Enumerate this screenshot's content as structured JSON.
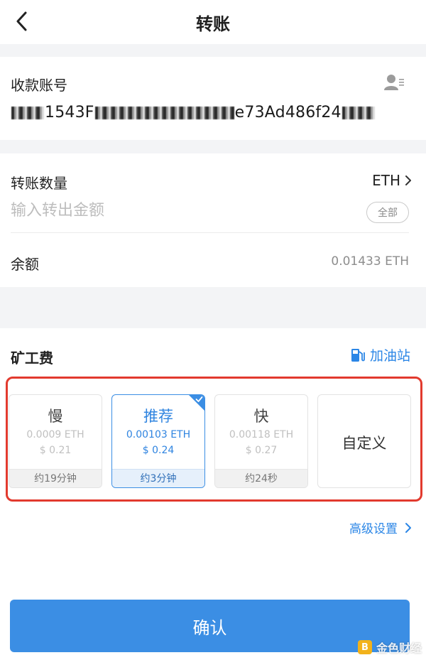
{
  "header": {
    "title": "转账",
    "back_icon": "chevron-left-icon"
  },
  "recipient": {
    "label": "收款账号",
    "address_prefix": "0x",
    "address_visible_1": "1543F",
    "address_visible_2": "e73Ad486f24",
    "contact_icon": "contact-book-icon"
  },
  "amount": {
    "label": "转账数量",
    "token": "ETH",
    "placeholder": "输入转出金额",
    "all_button": "全部",
    "balance_label": "余额",
    "balance_value": "0.01433 ETH"
  },
  "fee": {
    "title": "矿工费",
    "gas_station_label": "加油站",
    "gas_station_icon": "fuel-pump-icon",
    "highlight_color": "#e23a2e",
    "options": [
      {
        "name": "慢",
        "eth": "0.0009 ETH",
        "usd": "$ 0.21",
        "time": "约19分钟",
        "selected": false
      },
      {
        "name": "推荐",
        "eth": "0.00103 ETH",
        "usd": "$ 0.24",
        "time": "约3分钟",
        "selected": true
      },
      {
        "name": "快",
        "eth": "0.00118 ETH",
        "usd": "$ 0.27",
        "time": "约24秒",
        "selected": false
      },
      {
        "name": "自定义",
        "selected": false
      }
    ],
    "advanced_label": "高级设置"
  },
  "confirm_button": "确认",
  "accent_color": "#3b8ee4",
  "watermark": {
    "text": "金色财经",
    "logo_char": "B"
  }
}
